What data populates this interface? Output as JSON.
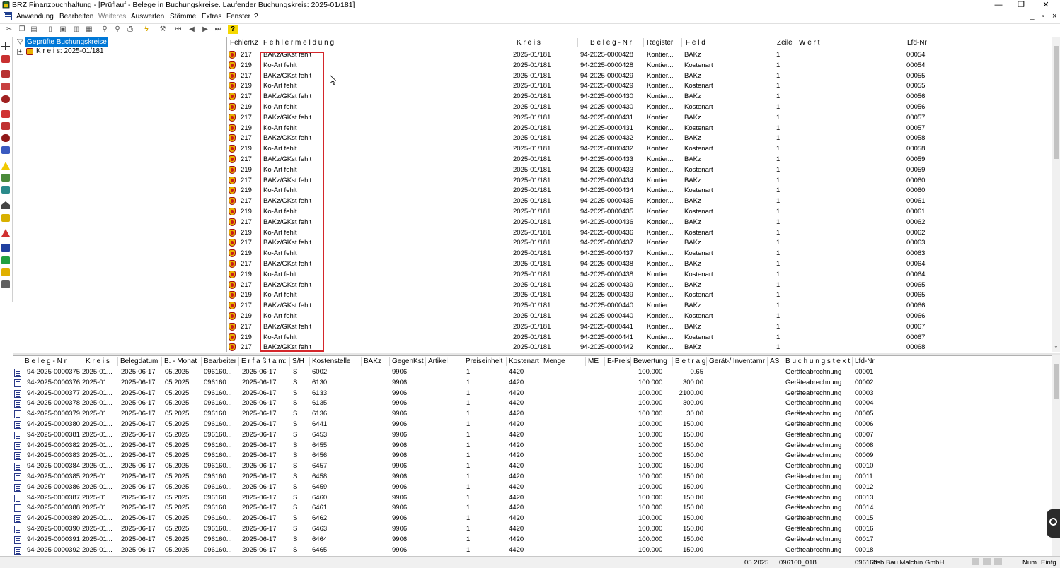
{
  "window": {
    "title": "BRZ Finanzbuchhaltung - [Prüflauf - Belege in Buchungskreise. Laufender Buchungskreis: 2025-01/181]",
    "minimize": "—",
    "restore": "❐",
    "close": "✕",
    "child_minimize": "_",
    "child_restore": "▫",
    "child_close": "×"
  },
  "menu": [
    "Anwendung",
    "Bearbeiten",
    "Weiteres",
    "Auswerten",
    "Stämme",
    "Extras",
    "Fenster",
    "?"
  ],
  "toolbar_icons": [
    "cut-icon",
    "copy-icon",
    "paste-icon",
    "new-icon",
    "save-icon",
    "delete-icon",
    "duplicate-icon",
    "find-icon",
    "find-next-icon",
    "print-icon",
    "lightning-icon",
    "wrench-icon",
    "first-record-icon",
    "prev-record-icon",
    "next-record-icon",
    "last-record-icon",
    "help-icon"
  ],
  "tree": {
    "root": "Geprüfte Buchungskreise",
    "child": "K r e i s: 2025-01/181"
  },
  "upper_grid": {
    "headers": [
      "FehlerKz",
      "F e h l e r m e l d u n g",
      "K r e i s",
      "B e l e g - N r",
      "Register",
      "F e l d",
      "Zeile",
      "W e r t",
      "Lfd-Nr"
    ],
    "rows": [
      [
        "217",
        "BAKz/GKst fehlt",
        "2025-01/181",
        "94-2025-0000428",
        "Kontier...",
        "BAKz",
        "1",
        "",
        "00054"
      ],
      [
        "219",
        "Ko-Art fehlt",
        "2025-01/181",
        "94-2025-0000428",
        "Kontier...",
        "Kostenart",
        "1",
        "",
        "00054"
      ],
      [
        "217",
        "BAKz/GKst fehlt",
        "2025-01/181",
        "94-2025-0000429",
        "Kontier...",
        "BAKz",
        "1",
        "",
        "00055"
      ],
      [
        "219",
        "Ko-Art fehlt",
        "2025-01/181",
        "94-2025-0000429",
        "Kontier...",
        "Kostenart",
        "1",
        "",
        "00055"
      ],
      [
        "217",
        "BAKz/GKst fehlt",
        "2025-01/181",
        "94-2025-0000430",
        "Kontier...",
        "BAKz",
        "1",
        "",
        "00056"
      ],
      [
        "219",
        "Ko-Art fehlt",
        "2025-01/181",
        "94-2025-0000430",
        "Kontier...",
        "Kostenart",
        "1",
        "",
        "00056"
      ],
      [
        "217",
        "BAKz/GKst fehlt",
        "2025-01/181",
        "94-2025-0000431",
        "Kontier...",
        "BAKz",
        "1",
        "",
        "00057"
      ],
      [
        "219",
        "Ko-Art fehlt",
        "2025-01/181",
        "94-2025-0000431",
        "Kontier...",
        "Kostenart",
        "1",
        "",
        "00057"
      ],
      [
        "217",
        "BAKz/GKst fehlt",
        "2025-01/181",
        "94-2025-0000432",
        "Kontier...",
        "BAKz",
        "1",
        "",
        "00058"
      ],
      [
        "219",
        "Ko-Art fehlt",
        "2025-01/181",
        "94-2025-0000432",
        "Kontier...",
        "Kostenart",
        "1",
        "",
        "00058"
      ],
      [
        "217",
        "BAKz/GKst fehlt",
        "2025-01/181",
        "94-2025-0000433",
        "Kontier...",
        "BAKz",
        "1",
        "",
        "00059"
      ],
      [
        "219",
        "Ko-Art fehlt",
        "2025-01/181",
        "94-2025-0000433",
        "Kontier...",
        "Kostenart",
        "1",
        "",
        "00059"
      ],
      [
        "217",
        "BAKz/GKst fehlt",
        "2025-01/181",
        "94-2025-0000434",
        "Kontier...",
        "BAKz",
        "1",
        "",
        "00060"
      ],
      [
        "219",
        "Ko-Art fehlt",
        "2025-01/181",
        "94-2025-0000434",
        "Kontier...",
        "Kostenart",
        "1",
        "",
        "00060"
      ],
      [
        "217",
        "BAKz/GKst fehlt",
        "2025-01/181",
        "94-2025-0000435",
        "Kontier...",
        "BAKz",
        "1",
        "",
        "00061"
      ],
      [
        "219",
        "Ko-Art fehlt",
        "2025-01/181",
        "94-2025-0000435",
        "Kontier...",
        "Kostenart",
        "1",
        "",
        "00061"
      ],
      [
        "217",
        "BAKz/GKst fehlt",
        "2025-01/181",
        "94-2025-0000436",
        "Kontier...",
        "BAKz",
        "1",
        "",
        "00062"
      ],
      [
        "219",
        "Ko-Art fehlt",
        "2025-01/181",
        "94-2025-0000436",
        "Kontier...",
        "Kostenart",
        "1",
        "",
        "00062"
      ],
      [
        "217",
        "BAKz/GKst fehlt",
        "2025-01/181",
        "94-2025-0000437",
        "Kontier...",
        "BAKz",
        "1",
        "",
        "00063"
      ],
      [
        "219",
        "Ko-Art fehlt",
        "2025-01/181",
        "94-2025-0000437",
        "Kontier...",
        "Kostenart",
        "1",
        "",
        "00063"
      ],
      [
        "217",
        "BAKz/GKst fehlt",
        "2025-01/181",
        "94-2025-0000438",
        "Kontier...",
        "BAKz",
        "1",
        "",
        "00064"
      ],
      [
        "219",
        "Ko-Art fehlt",
        "2025-01/181",
        "94-2025-0000438",
        "Kontier...",
        "Kostenart",
        "1",
        "",
        "00064"
      ],
      [
        "217",
        "BAKz/GKst fehlt",
        "2025-01/181",
        "94-2025-0000439",
        "Kontier...",
        "BAKz",
        "1",
        "",
        "00065"
      ],
      [
        "219",
        "Ko-Art fehlt",
        "2025-01/181",
        "94-2025-0000439",
        "Kontier...",
        "Kostenart",
        "1",
        "",
        "00065"
      ],
      [
        "217",
        "BAKz/GKst fehlt",
        "2025-01/181",
        "94-2025-0000440",
        "Kontier...",
        "BAKz",
        "1",
        "",
        "00066"
      ],
      [
        "219",
        "Ko-Art fehlt",
        "2025-01/181",
        "94-2025-0000440",
        "Kontier...",
        "Kostenart",
        "1",
        "",
        "00066"
      ],
      [
        "217",
        "BAKz/GKst fehlt",
        "2025-01/181",
        "94-2025-0000441",
        "Kontier...",
        "BAKz",
        "1",
        "",
        "00067"
      ],
      [
        "219",
        "Ko-Art fehlt",
        "2025-01/181",
        "94-2025-0000441",
        "Kontier...",
        "Kostenart",
        "1",
        "",
        "00067"
      ],
      [
        "217",
        "BAKz/GKst fehlt",
        "2025-01/181",
        "94-2025-0000442",
        "Kontier...",
        "BAKz",
        "1",
        "",
        "00068"
      ]
    ]
  },
  "lower_grid": {
    "headers": [
      "B e l e g - N r",
      "K r e i s",
      "Belegdatum",
      "B. - Monat",
      "Bearbeiter",
      "E r f a ß t  a m:",
      "S/H",
      "Kostenstelle",
      "BAKz",
      "GegenKst",
      "Artikel",
      "Preiseinheit",
      "Kostenart",
      "Menge",
      "ME",
      "E-Preis",
      "Bewertung",
      "B e t r a g",
      "Gerät-/ Inventarnr",
      "AS",
      "B u c h u n g s t e x t",
      "Lfd-Nr"
    ],
    "rows": [
      [
        "94-2025-0000375",
        "2025-01...",
        "2025-06-17",
        "05.2025",
        "096160...",
        "2025-06-17",
        "S",
        "6002",
        "",
        "9906",
        "",
        "1",
        "4420",
        "",
        "",
        "",
        "100.000",
        "0.65",
        "",
        "",
        "Geräteabrechnung",
        "00001"
      ],
      [
        "94-2025-0000376",
        "2025-01...",
        "2025-06-17",
        "05.2025",
        "096160...",
        "2025-06-17",
        "S",
        "6130",
        "",
        "9906",
        "",
        "1",
        "4420",
        "",
        "",
        "",
        "100.000",
        "300.00",
        "",
        "",
        "Geräteabrechnung",
        "00002"
      ],
      [
        "94-2025-0000377",
        "2025-01...",
        "2025-06-17",
        "05.2025",
        "096160...",
        "2025-06-17",
        "S",
        "6133",
        "",
        "9906",
        "",
        "1",
        "4420",
        "",
        "",
        "",
        "100.000",
        "2100.00",
        "",
        "",
        "Geräteabrechnung",
        "00003"
      ],
      [
        "94-2025-0000378",
        "2025-01...",
        "2025-06-17",
        "05.2025",
        "096160...",
        "2025-06-17",
        "S",
        "6135",
        "",
        "9906",
        "",
        "1",
        "4420",
        "",
        "",
        "",
        "100.000",
        "300.00",
        "",
        "",
        "Geräteabrechnung",
        "00004"
      ],
      [
        "94-2025-0000379",
        "2025-01...",
        "2025-06-17",
        "05.2025",
        "096160...",
        "2025-06-17",
        "S",
        "6136",
        "",
        "9906",
        "",
        "1",
        "4420",
        "",
        "",
        "",
        "100.000",
        "30.00",
        "",
        "",
        "Geräteabrechnung",
        "00005"
      ],
      [
        "94-2025-0000380",
        "2025-01...",
        "2025-06-17",
        "05.2025",
        "096160...",
        "2025-06-17",
        "S",
        "6441",
        "",
        "9906",
        "",
        "1",
        "4420",
        "",
        "",
        "",
        "100.000",
        "150.00",
        "",
        "",
        "Geräteabrechnung",
        "00006"
      ],
      [
        "94-2025-0000381",
        "2025-01...",
        "2025-06-17",
        "05.2025",
        "096160...",
        "2025-06-17",
        "S",
        "6453",
        "",
        "9906",
        "",
        "1",
        "4420",
        "",
        "",
        "",
        "100.000",
        "150.00",
        "",
        "",
        "Geräteabrechnung",
        "00007"
      ],
      [
        "94-2025-0000382",
        "2025-01...",
        "2025-06-17",
        "05.2025",
        "096160...",
        "2025-06-17",
        "S",
        "6455",
        "",
        "9906",
        "",
        "1",
        "4420",
        "",
        "",
        "",
        "100.000",
        "150.00",
        "",
        "",
        "Geräteabrechnung",
        "00008"
      ],
      [
        "94-2025-0000383",
        "2025-01...",
        "2025-06-17",
        "05.2025",
        "096160...",
        "2025-06-17",
        "S",
        "6456",
        "",
        "9906",
        "",
        "1",
        "4420",
        "",
        "",
        "",
        "100.000",
        "150.00",
        "",
        "",
        "Geräteabrechnung",
        "00009"
      ],
      [
        "94-2025-0000384",
        "2025-01...",
        "2025-06-17",
        "05.2025",
        "096160...",
        "2025-06-17",
        "S",
        "6457",
        "",
        "9906",
        "",
        "1",
        "4420",
        "",
        "",
        "",
        "100.000",
        "150.00",
        "",
        "",
        "Geräteabrechnung",
        "00010"
      ],
      [
        "94-2025-0000385",
        "2025-01...",
        "2025-06-17",
        "05.2025",
        "096160...",
        "2025-06-17",
        "S",
        "6458",
        "",
        "9906",
        "",
        "1",
        "4420",
        "",
        "",
        "",
        "100.000",
        "150.00",
        "",
        "",
        "Geräteabrechnung",
        "00011"
      ],
      [
        "94-2025-0000386",
        "2025-01...",
        "2025-06-17",
        "05.2025",
        "096160...",
        "2025-06-17",
        "S",
        "6459",
        "",
        "9906",
        "",
        "1",
        "4420",
        "",
        "",
        "",
        "100.000",
        "150.00",
        "",
        "",
        "Geräteabrechnung",
        "00012"
      ],
      [
        "94-2025-0000387",
        "2025-01...",
        "2025-06-17",
        "05.2025",
        "096160...",
        "2025-06-17",
        "S",
        "6460",
        "",
        "9906",
        "",
        "1",
        "4420",
        "",
        "",
        "",
        "100.000",
        "150.00",
        "",
        "",
        "Geräteabrechnung",
        "00013"
      ],
      [
        "94-2025-0000388",
        "2025-01...",
        "2025-06-17",
        "05.2025",
        "096160...",
        "2025-06-17",
        "S",
        "6461",
        "",
        "9906",
        "",
        "1",
        "4420",
        "",
        "",
        "",
        "100.000",
        "150.00",
        "",
        "",
        "Geräteabrechnung",
        "00014"
      ],
      [
        "94-2025-0000389",
        "2025-01...",
        "2025-06-17",
        "05.2025",
        "096160...",
        "2025-06-17",
        "S",
        "6462",
        "",
        "9906",
        "",
        "1",
        "4420",
        "",
        "",
        "",
        "100.000",
        "150.00",
        "",
        "",
        "Geräteabrechnung",
        "00015"
      ],
      [
        "94-2025-0000390",
        "2025-01...",
        "2025-06-17",
        "05.2025",
        "096160...",
        "2025-06-17",
        "S",
        "6463",
        "",
        "9906",
        "",
        "1",
        "4420",
        "",
        "",
        "",
        "100.000",
        "150.00",
        "",
        "",
        "Geräteabrechnung",
        "00016"
      ],
      [
        "94-2025-0000391",
        "2025-01...",
        "2025-06-17",
        "05.2025",
        "096160...",
        "2025-06-17",
        "S",
        "6464",
        "",
        "9906",
        "",
        "1",
        "4420",
        "",
        "",
        "",
        "100.000",
        "150.00",
        "",
        "",
        "Geräteabrechnung",
        "00017"
      ],
      [
        "94-2025-0000392",
        "2025-01...",
        "2025-06-17",
        "05.2025",
        "096160...",
        "2025-06-17",
        "S",
        "6465",
        "",
        "9906",
        "",
        "1",
        "4420",
        "",
        "",
        "",
        "100.000",
        "150.00",
        "",
        "",
        "Geräteabrechnung",
        "00018"
      ]
    ]
  },
  "statusbar": [
    "05.2025",
    "096160_018",
    "096160",
    "bsb Bau Malchin GmbH",
    "Num",
    "Einfg."
  ],
  "colors": {
    "selection": "#0078d7",
    "highlight_border": "#d4262b",
    "error_icon": "#e8b000"
  }
}
